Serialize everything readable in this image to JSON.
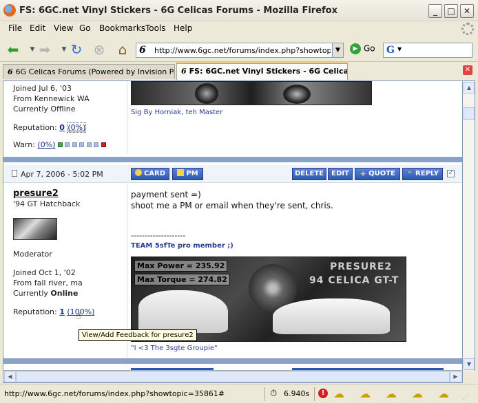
{
  "window": {
    "title": "FS: 6GC.net Vinyl Stickers - 6G Celicas Forums - Mozilla Firefox"
  },
  "menu": [
    "File",
    "Edit",
    "View",
    "Go",
    "Bookmarks",
    "Tools",
    "Help"
  ],
  "address_bar": {
    "url": "http://www.6gc.net/forums/index.php?showtopic",
    "site_icon_text": "6",
    "go_label": "Go"
  },
  "search": {
    "engine_icon": "G"
  },
  "tabs": [
    {
      "label": "6G Celicas Forums (Powered by Invision Po...",
      "icon": "6",
      "active": false
    },
    {
      "label": "FS: 6GC.net Vinyl Stickers - 6G Celicas...",
      "icon": "6",
      "active": true
    }
  ],
  "prev_post": {
    "joined": "Joined Jul 6, '03",
    "from": "From Kennewick WA",
    "status": "Currently Offline",
    "reputation_label": "Reputation:",
    "reputation_value": "0",
    "reputation_pct": "(0%)",
    "warn_label": "Warn:",
    "warn_pct": "(0%)",
    "sig_caption": "Sig By Horniak, teh Master"
  },
  "post": {
    "date": "Apr 7, 2006 - 5:02 PM",
    "buttons": {
      "card": "CARD",
      "pm": "PM",
      "delete": "DELETE",
      "edit": "EDIT",
      "quote": "QUOTE",
      "reply": "REPLY"
    },
    "author": "presure2",
    "car": "'94 GT Hatchback",
    "role": "Moderator",
    "joined": "Joined Oct 1, '02",
    "from": "From fall river, ma",
    "status_prefix": "Currently",
    "status_value": "Online",
    "reputation_label": "Reputation:",
    "reputation_value": "1",
    "reputation_pct": "(100%)",
    "body_line1": "payment sent =)",
    "body_line2": "shoot me a PM or email when they're sent, chris.",
    "separator": "--------------------",
    "team_line": "TEAM 5sfTe pro member ;)",
    "sig_banner_title1": "PRESURE2",
    "sig_banner_title2": "94 CELICA GT-T",
    "sig_power": "Max Power = 235.92",
    "sig_torque": "Max Torque = 274.82",
    "sig_caption": "\"I <3 The 3sgte Groupie\""
  },
  "tooltip": "View/Add Feedback for presure2",
  "status_bar": {
    "url": "http://www.6gc.net/forums/index.php?showtopic=35861#",
    "load_time": "6.940s"
  },
  "colors": {
    "divider": "#8ba2c8",
    "button": "#2e57b5",
    "link": "#1a2e8c"
  }
}
